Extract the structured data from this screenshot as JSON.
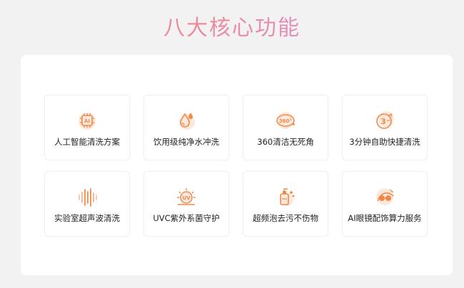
{
  "page": {
    "title": "八大核心功能"
  },
  "features": [
    {
      "label": "人工智能清洗方案",
      "icon": "ai-chip-icon"
    },
    {
      "label": "饮用级纯净水冲洗",
      "icon": "water-drops-icon"
    },
    {
      "label": "360清洁无死角",
      "icon": "rotation-360-icon"
    },
    {
      "label": "3分钟自助快捷清洗",
      "icon": "timer-3min-icon"
    },
    {
      "label": "实验室超声波清洗",
      "icon": "ultrasonic-wave-icon"
    },
    {
      "label": "UVC紫外系菌守护",
      "icon": "uv-sun-icon"
    },
    {
      "label": "超频泡去污不伤物",
      "icon": "foam-bottle-icon"
    },
    {
      "label": "AI眼镜配饰算力服务",
      "icon": "glasses-service-icon"
    }
  ],
  "icon_glyphs": {
    "ai_chip": "AI",
    "rotation": "360°",
    "timer": "3",
    "uv": "UV"
  },
  "colors": {
    "accent": "#f08a4b",
    "accent_light": "#f7c4a4",
    "title_gradient": [
      "#f08a6c",
      "#ec8aa6",
      "#c59be8"
    ]
  }
}
